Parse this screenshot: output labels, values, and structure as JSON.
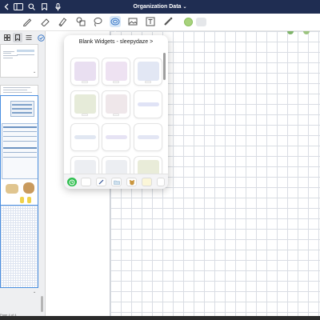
{
  "window": {
    "title": "Organization Data",
    "title_chevron": "⌄"
  },
  "toolbar": {
    "tools": [
      "pen-tool",
      "eraser-tool",
      "highlighter-tool",
      "shapes-tool",
      "lasso-tool",
      "stickers-tool",
      "image-tool",
      "text-tool",
      "laser-tool"
    ],
    "active_tool": "stickers-tool",
    "colors": [
      "#a7d27c",
      "#e5e7ea"
    ]
  },
  "sidebar": {
    "page_label": "Page 4 of 4"
  },
  "popover": {
    "title": "Blank Widgets - sleepydaze",
    "title_chevron": ">",
    "widgets": [
      {
        "kind": "square",
        "color": "#e9dff1"
      },
      {
        "kind": "square",
        "color": "#eee2f2"
      },
      {
        "kind": "square",
        "color": "#e2e7f4"
      },
      {
        "kind": "square",
        "color": "#e6ebd9"
      },
      {
        "kind": "square",
        "color": "#efe7ea"
      },
      {
        "kind": "pill",
        "color": "#e0e3f6"
      },
      {
        "kind": "pill",
        "color": "#e1e7f2"
      },
      {
        "kind": "pill",
        "color": "#e6e3f4"
      },
      {
        "kind": "pill",
        "color": "#e3e6f4"
      },
      {
        "kind": "square",
        "color": "#eceef2"
      },
      {
        "kind": "square",
        "color": "#eceef2"
      },
      {
        "kind": "square",
        "color": "#e9ecd9"
      }
    ],
    "footer_items": [
      "recent",
      "blank",
      "pen-sticker",
      "folder",
      "bear",
      "note",
      "more"
    ]
  }
}
